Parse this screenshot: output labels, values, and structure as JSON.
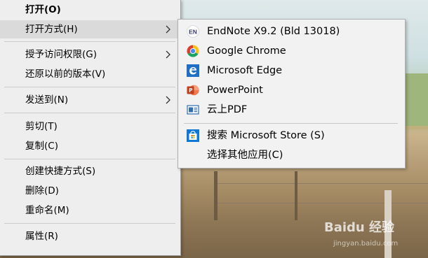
{
  "context_menu": {
    "items": [
      {
        "label": "打开(O)",
        "bold": true
      },
      {
        "label": "打开方式(H)",
        "submenu": true
      },
      {
        "label": "授予访问权限(G)",
        "submenu": true
      },
      {
        "label": "还原以前的版本(V)"
      },
      {
        "label": "发送到(N)",
        "submenu": true
      },
      {
        "label": "剪切(T)"
      },
      {
        "label": "复制(C)"
      },
      {
        "label": "创建快捷方式(S)"
      },
      {
        "label": "删除(D)"
      },
      {
        "label": "重命名(M)"
      },
      {
        "label": "属性(R)"
      }
    ]
  },
  "open_with_submenu": {
    "items": [
      {
        "label": "EndNote X9.2 (Bld 13018)",
        "icon": "endnote-icon",
        "icon_text": "EN"
      },
      {
        "label": "Google Chrome",
        "icon": "chrome-icon"
      },
      {
        "label": "Microsoft Edge",
        "icon": "edge-icon"
      },
      {
        "label": "PowerPoint",
        "icon": "powerpoint-icon"
      },
      {
        "label": "云上PDF",
        "icon": "pdf-icon"
      },
      {
        "label": "搜索 Microsoft Store (S)",
        "icon": "store-icon"
      },
      {
        "label": "选择其他应用(C)"
      }
    ]
  },
  "watermark": {
    "text": "Baidu 经验",
    "sub": "jingyan.baidu.com"
  },
  "colors": {
    "menu_bg": "#eeeeee",
    "hover_bg": "#dadada",
    "edge_blue": "#1f6fc5",
    "powerpoint": "#d24726",
    "store_blue": "#0f78d4"
  }
}
